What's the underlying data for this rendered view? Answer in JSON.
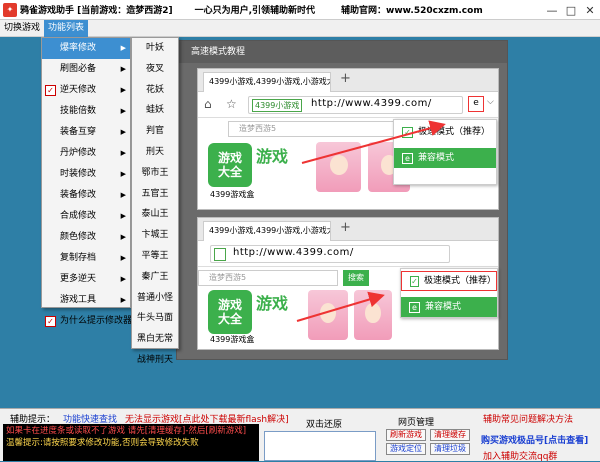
{
  "titlebar": {
    "title": "鸦雀游戏助手 [当前游戏：造梦西游2]",
    "slogan": "一心只为用户,引领辅助新时代",
    "site": "辅助官网：www.520cxzm.com",
    "minimize": "—",
    "maximize": "□",
    "close": "✕"
  },
  "menubar": {
    "items": [
      "切换游戏",
      "功能列表"
    ]
  },
  "menu_primary": {
    "items": [
      {
        "label": "爆率修改",
        "check": "",
        "arrow": "▶"
      },
      {
        "label": "刷图必备",
        "check": "",
        "arrow": "▶"
      },
      {
        "label": "逆天修改",
        "check": "✓",
        "arrow": "▶"
      },
      {
        "label": "技能倍数",
        "check": "",
        "arrow": "▶"
      },
      {
        "label": "装备互穿",
        "check": "",
        "arrow": "▶"
      },
      {
        "label": "丹炉修改",
        "check": "",
        "arrow": "▶"
      },
      {
        "label": "时装修改",
        "check": "",
        "arrow": "▶"
      },
      {
        "label": "装备修改",
        "check": "",
        "arrow": "▶"
      },
      {
        "label": "合成修改",
        "check": "",
        "arrow": "▶"
      },
      {
        "label": "颜色修改",
        "check": "",
        "arrow": "▶"
      },
      {
        "label": "复制存档",
        "check": "",
        "arrow": "▶"
      },
      {
        "label": "更多逆天",
        "check": "",
        "arrow": "▶"
      },
      {
        "label": "游戏工具",
        "check": "",
        "arrow": "▶"
      },
      {
        "label": "为什么提示修改器",
        "check": "✓",
        "arrow": ""
      }
    ]
  },
  "menu_secondary": {
    "items": [
      "叶妖",
      "夜叉",
      "花妖",
      "蛙妖",
      "判官",
      "刑天",
      "鄂市王",
      "五官王",
      "泰山王",
      "卞城王",
      "平等王",
      "秦广王",
      "普通小怪",
      "牛头马面",
      "黑白无常",
      "战神刑天"
    ]
  },
  "tutorial": {
    "title": "高速模式教程",
    "tab_title": "4399小游戏,4399小游戏,小游戏大全",
    "new_tab": "+",
    "site_badge": "4399小游戏",
    "url1": "http://www.4399.com/",
    "url2": "http://www.4399.com/",
    "search_placeholder": "造梦西游5",
    "search_button": "搜索",
    "dropdown": {
      "fast": "极速模式（推荐）",
      "compat": "兼容模式"
    },
    "game_cube": [
      "游戏",
      "大全"
    ],
    "game_word": "游戏",
    "game_label": "4399游戏盒",
    "ie_icon": "e",
    "caret": "⌵",
    "home_icon": "⌂",
    "star_icon": "☆",
    "check_icon": "✓",
    "e_icon": "e"
  },
  "bottom": {
    "hint_label": "辅助提示：",
    "hint_link1": "功能快速查找",
    "hint_link2": "无法显示游戏[点此处下载最新flash解决]",
    "status_lines": [
      "如果卡在进度条或读取不了游戏 请先[清理缓存]-然后[刷新游戏]",
      "温馨提示:请按照要求修改功能,否则会导致修改失败",
      ""
    ],
    "double_click_label": "双击还原",
    "web_manage_label": "网页管理",
    "btn_refresh": "刷新游戏",
    "btn_clear": "清理缓存",
    "btn_locate": "游戏定位",
    "btn_cleanup": "清理垃圾",
    "faq": "辅助常见问题解决方法",
    "buy": "购买游戏极品号[点击查看]",
    "join": "加入辅助交流qq群"
  },
  "colors": {
    "accent": "#3d8fd1",
    "workspace": "#2e7fa6",
    "green": "#3cb04c",
    "arrow_red": "#e33"
  }
}
